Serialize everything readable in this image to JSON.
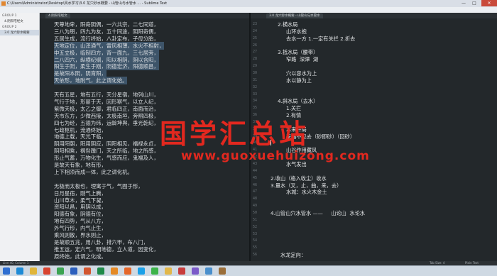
{
  "window": {
    "title": "C:\\Users\\Administrator\\Desktop\\风水学习\\3.0 龙穴砂水概要 - 山管山与水管水 ... - Sublime Text",
    "btn_minimize": "—",
    "btn_maximize": "□",
    "btn_close": "✕"
  },
  "menu": [
    "文件(F)",
    "编辑(E)",
    "选择(S)",
    "查找(I)",
    "视图(V)",
    "转到(G)",
    "工具(T)",
    "项目(P)",
    "首选项(N)",
    "帮助(H)"
  ],
  "sidebar": {
    "group1": "GROUP 1",
    "group1_files": [
      "4.阴阳宅经文"
    ],
    "group2": "GROUP 2",
    "group2_files": [
      "3.0 龙穴砂水概要"
    ]
  },
  "tabs": {
    "left": "4.阴阳宅经文",
    "right": "3.0 龙穴砂水概要 - 山管山与水管水"
  },
  "left_lines": [
    "天尊地卑，阳奇阴偶，一六共宗，二七同道，",
    "三八为朋，四九为友，五十同途，阴阳奇偶，",
    "五居生成，流行终始，八卦定布，子母分胎，",
    "天地定位，山泽通气，雷风相薄，水火不相射，",
    "中五立极，临制四方，背一面九，三七居旁，",
    "二八四六，纵横纪纲，阳以相阴，阴以含阳，",
    "阳生于阴，柔生于刚，阴德宏济，阳德顺昌，",
    "是故阳本阴，阴育阳，",
    "天依形，地附气，此之谓化始。",
    "",
    "天有五星，地有五行，天分星宿，地列山川，",
    "气行于地，形丽于天，因形察气，以立人纪，",
    "紫微天极，太乙之御，君临四正，南面而治，",
    "天市东方，少微西掖，太极南垣，旁照四极，",
    "四七为经，五德为纬，运斡坤舆，垂光乾纪，",
    "七政枢机，流通终始，",
    "地德上载，天光下临，",
    "阴用阳朝，阳用阴应，阴阳相见，福禄永贞，",
    "阴阳相乘，祸咎踵门，天之所临，地之所感，",
    "形止气蓄，万物化生，气感而应，鬼福及人，",
    "是故天有象，地有形，",
    "上下相须而成一体，此之谓化机。",
    "",
    "无极而太极也，理寓于气，气囿于形，",
    "日月星宿，刚气上腾，",
    "山川草木，柔气下凝，",
    "资阳以昌，用阴以成，",
    "阳德有象，阴德有位，",
    "地有四势，气从八方，",
    "外气行形，内气止生，",
    "乘风则散，界水则止，",
    "是故顺五兆，用八卦，排六甲，布八门，",
    "推五运，定六气，明地德，立人道，因变化，",
    "原终始，此谓之化成。"
  ],
  "right_lines": [
    "2.横水局",
    "山环水抱",
    "去水一方 1.一定有关拦 2.折去",
    "",
    "3.抵水局（腰带）",
    "窄路  深潭  湖",
    "",
    "穴以容水为上",
    "水以静为上",
    "",
    "",
    "4.斜水局（去水）",
    "1.关拦",
    "2.有情",
    "",
    "水来开局",
    "来路不见去（砂即砂）（回砂）",
    "",
    "山谷作用藏风",
    "",
    "水气发出",
    "",
    "2.收山（格入收尘）收水",
    "3.量水（叉，止，曲，来，去）",
    "水城：水火木金土",
    "",
    "",
    "4.山管山穴水管水 ——     山论山  水论水",
    "",
    "",
    "",
    "",
    "",
    "水龙定向："
  ],
  "right_line_numbers": [
    23,
    24,
    25,
    26,
    27,
    28,
    29,
    30,
    31,
    32,
    33,
    34,
    35,
    36,
    37,
    38,
    39,
    40,
    41,
    42,
    43,
    44,
    45,
    46,
    47,
    48,
    49,
    50,
    51,
    52,
    53,
    54,
    55,
    56
  ],
  "status": {
    "left": "Line 40, Column 1",
    "right_tab": "Tab Size: 4",
    "right_syntax": "Plain Text"
  },
  "watermark": {
    "main": "国学汇总站",
    "url": "www.guoxuehuizong.com"
  },
  "taskbar_icons": [
    "start-orb",
    "ie",
    "explorer",
    "media",
    "chrome",
    "word",
    "powerpoint",
    "excel",
    "sublime",
    "firefox",
    "qq",
    "wechat",
    "folder",
    "pdf",
    "player",
    "app1",
    "app2"
  ],
  "colors": {
    "editor_bg": "#23282b",
    "selection": "#3d5469",
    "watermark": "#e2281f"
  }
}
